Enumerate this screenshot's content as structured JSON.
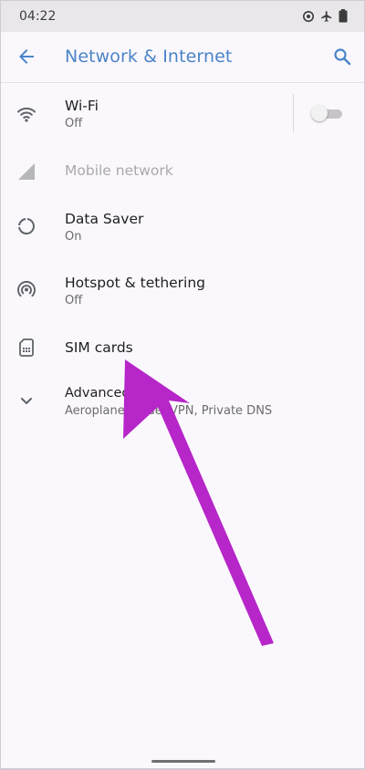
{
  "status_bar": {
    "time": "04:22",
    "icons": [
      "location-icon",
      "airplane-mode-icon",
      "battery-icon"
    ]
  },
  "app_bar": {
    "title": "Network & Internet",
    "back_icon": "back-arrow-icon",
    "search_icon": "search-icon"
  },
  "items": [
    {
      "icon": "wifi-icon",
      "title": "Wi-Fi",
      "subtitle": "Off",
      "toggle_on": false
    },
    {
      "icon": "mobile-signal-icon",
      "title": "Mobile network",
      "disabled": true
    },
    {
      "icon": "data-saver-icon",
      "title": "Data Saver",
      "subtitle": "On"
    },
    {
      "icon": "hotspot-icon",
      "title": "Hotspot & tethering",
      "subtitle": "Off"
    },
    {
      "icon": "sim-card-icon",
      "title": "SIM cards"
    },
    {
      "icon": "chevron-down-icon",
      "title": "Advanced",
      "subtitle": "Aeroplane mode, VPN, Private DNS"
    }
  ],
  "colors": {
    "accent": "#4a84c8",
    "annotation_arrow": "#b626c9",
    "background": "#fbf8fd"
  }
}
